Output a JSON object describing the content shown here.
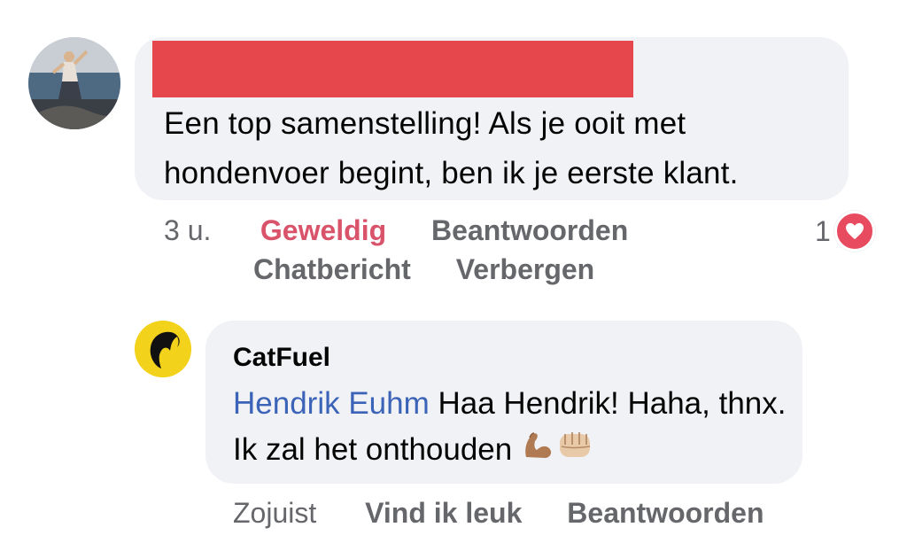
{
  "comment": {
    "text": "Een top samenstelling! Als je ooit met hondenvoer begint, ben ik je eerste klant.",
    "time": "3 u.",
    "reaction_label": "Geweldig",
    "reply_label": "Beantwoorden",
    "message_label": "Chatbericht",
    "hide_label": "Verbergen",
    "reaction_count": "1",
    "reaction_icon": "heart-icon",
    "reaction_color": "#e84a5f"
  },
  "reply": {
    "author": "CatFuel",
    "mention": "Hendrik Euhm",
    "text_line": " Haa Hendrik! Haha, thnx. Ik zal het onthouden ",
    "emojis": [
      "flexed-biceps-icon",
      "oncoming-fist-icon"
    ],
    "time": "Zojuist",
    "like_label": "Vind ik leuk",
    "reply_label": "Beantwoorden",
    "mention_color": "#3b63b8",
    "avatar_color": "#f3d21c"
  }
}
